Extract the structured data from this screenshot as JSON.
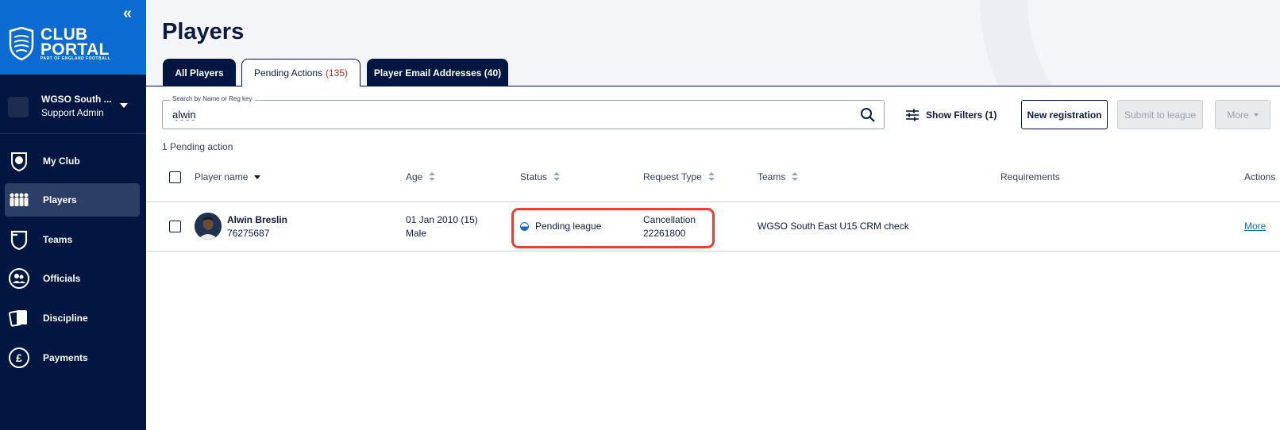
{
  "sidebar": {
    "logo_line1": "CLUB",
    "logo_line2": "PORTAL",
    "logo_sub": "PART OF ENGLAND FOOTBALL",
    "club_name": "WGSO South ...",
    "club_role": "Support Admin",
    "items": [
      {
        "label": "My Club",
        "icon": "club-crest-icon"
      },
      {
        "label": "Players",
        "icon": "players-icon"
      },
      {
        "label": "Teams",
        "icon": "shield-icon"
      },
      {
        "label": "Officials",
        "icon": "officials-icon"
      },
      {
        "label": "Discipline",
        "icon": "cards-icon"
      },
      {
        "label": "Payments",
        "icon": "pound-icon"
      }
    ]
  },
  "header": {
    "title": "Players",
    "tabs": [
      {
        "label": "All Players",
        "count": ""
      },
      {
        "label": "Pending Actions",
        "count": "(135)"
      },
      {
        "label": "Player Email Addresses (40)",
        "count": ""
      }
    ]
  },
  "search": {
    "label": "Search by Name or Reg key",
    "value": "alwin"
  },
  "toolbar": {
    "filters_label": "Show Filters (1)",
    "new_registration": "New registration",
    "submit_to_league": "Submit to league",
    "more": "More"
  },
  "results_count": "1 Pending action",
  "table": {
    "columns": {
      "player_name": "Player name",
      "age": "Age",
      "status": "Status",
      "request_type": "Request Type",
      "teams": "Teams",
      "requirements": "Requirements",
      "actions": "Actions"
    },
    "rows": [
      {
        "name": "Alwin Breslin",
        "reg_id": "76275687",
        "dob": "01 Jan 2010 (15)",
        "gender": "Male",
        "status": "Pending league",
        "request_type": "Cancellation",
        "request_id": "22261800",
        "team": "WGSO South East U15 CRM check",
        "requirements": "",
        "action": "More"
      }
    ]
  },
  "colors": {
    "sidebar_bg": "#011641",
    "brand_blue": "#0c6bd0",
    "highlight": "#e0432f",
    "count_red": "#c8291f"
  }
}
